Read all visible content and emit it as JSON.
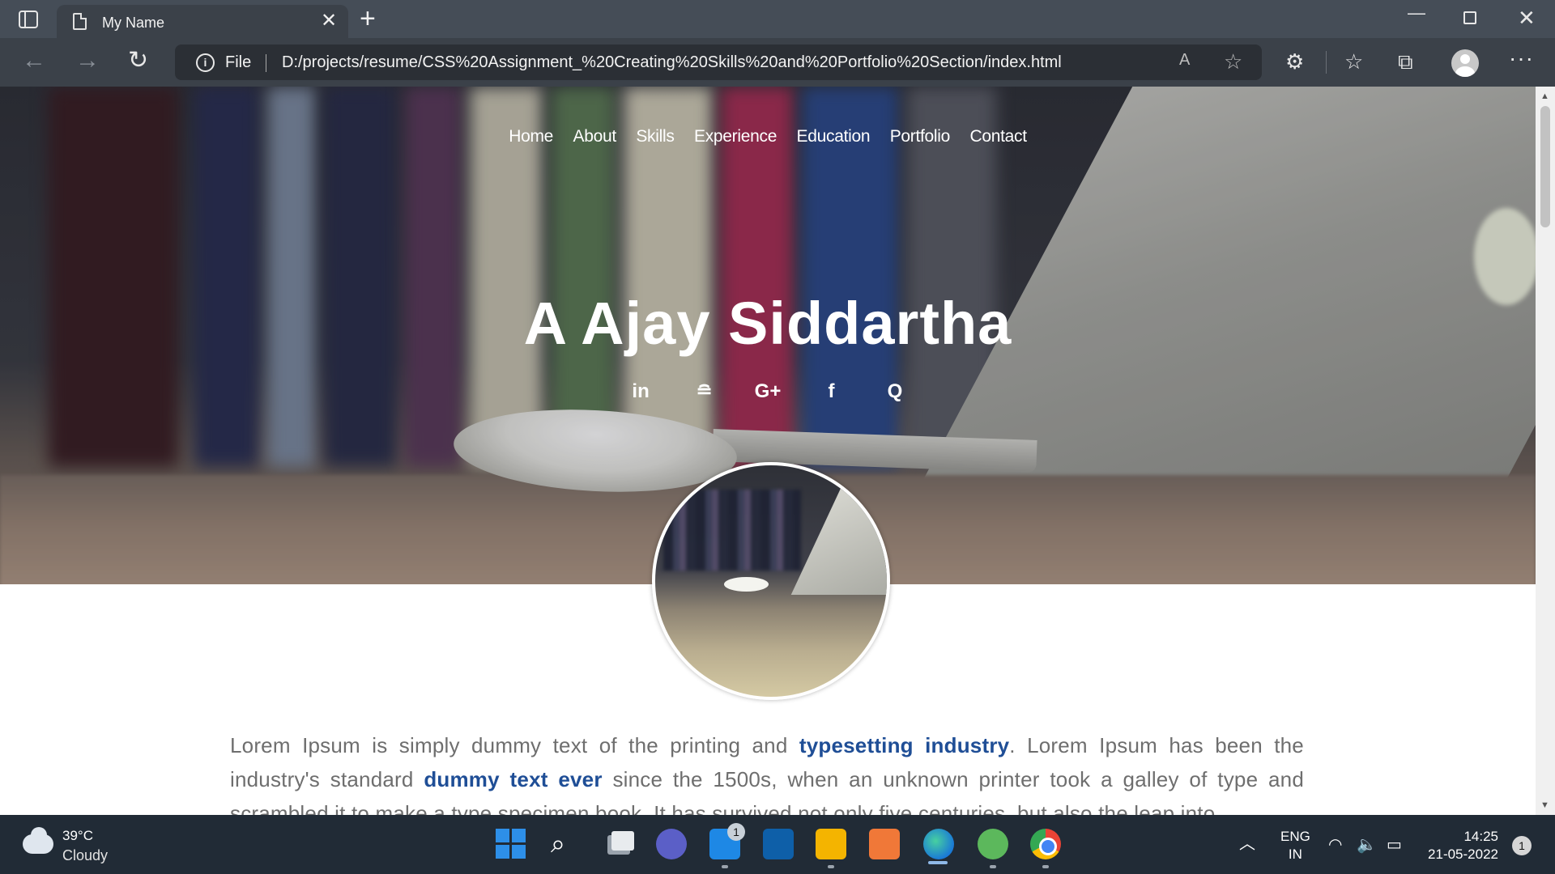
{
  "browser": {
    "tab_title": "My Name",
    "file_label": "File",
    "url": "D:/projects/resume/CSS%20Assignment_%20Creating%20Skills%20and%20Portfolio%20Section/index.html"
  },
  "page": {
    "nav": [
      "Home",
      "About",
      "Skills",
      "Experience",
      "Education",
      "Portfolio",
      "Contact"
    ],
    "name": "A Ajay Siddartha",
    "socials": [
      {
        "icon": "linkedin-icon",
        "glyph": "in"
      },
      {
        "icon": "stackoverflow-icon",
        "glyph": "≘"
      },
      {
        "icon": "google-plus-icon",
        "glyph": "G+"
      },
      {
        "icon": "facebook-icon",
        "glyph": "f"
      },
      {
        "icon": "quora-icon",
        "glyph": "Q"
      }
    ],
    "bio": {
      "p1": "Lorem Ipsum is simply dummy text of the printing and ",
      "b1": "typesetting industry",
      "p2": ". Lorem Ipsum has been the industry's standard ",
      "b2": "dummy text ever",
      "p3": " since the 1500s, when an unknown printer took a galley of type and scrambled it to make a type specimen book. It has survived not only five centuries, but also the leap into"
    },
    "colors": {
      "link": "#1f4e96",
      "body_text": "#6e6e6e"
    }
  },
  "taskbar": {
    "weather_temp": "39°C",
    "weather_cond": "Cloudy",
    "mail_badge": "1",
    "lang_line1": "ENG",
    "lang_line2": "IN",
    "time": "14:25",
    "date": "21-05-2022",
    "notifications": "1"
  }
}
